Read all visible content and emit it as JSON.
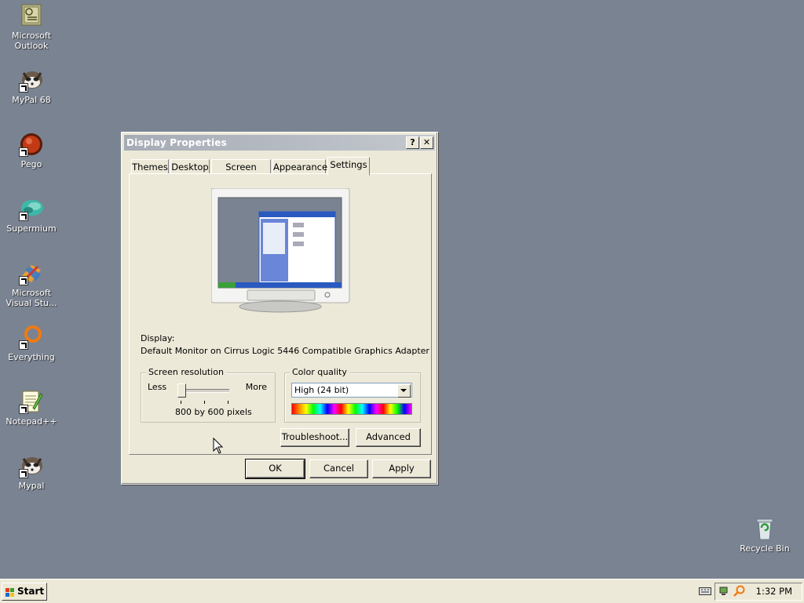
{
  "desktop": {
    "icons": [
      {
        "label": "Microsoft Outlook",
        "icon": "outlook-icon"
      },
      {
        "label": "MyPal 68",
        "icon": "raccoon-icon"
      },
      {
        "label": "Pego",
        "icon": "pego-icon"
      },
      {
        "label": "Supermium",
        "icon": "supermium-icon"
      },
      {
        "label": "Microsoft Visual Stu...",
        "icon": "visual-studio-icon"
      },
      {
        "label": "Everything",
        "icon": "everything-icon"
      },
      {
        "label": "Notepad++",
        "icon": "notepadpp-icon"
      },
      {
        "label": "Mypal",
        "icon": "raccoon-icon"
      }
    ],
    "recycle_bin": {
      "label": "Recycle Bin"
    }
  },
  "dialog": {
    "title": "Display Properties",
    "help_button": "?",
    "close_button": "✕",
    "tabs": [
      "Themes",
      "Desktop",
      "Screen Saver",
      "Appearance",
      "Settings"
    ],
    "active_tab": "Settings",
    "display_label": "Display:",
    "display_value": "Default Monitor on Cirrus Logic 5446 Compatible Graphics Adapter",
    "resolution": {
      "group_label": "Screen resolution",
      "less": "Less",
      "more": "More",
      "value_text": "800 by 600 pixels"
    },
    "color_quality": {
      "group_label": "Color quality",
      "selected": "High (24 bit)"
    },
    "troubleshoot_button": "Troubleshoot...",
    "advanced_button": "Advanced",
    "ok_button": "OK",
    "cancel_button": "Cancel",
    "apply_button": "Apply"
  },
  "taskbar": {
    "start_label": "Start",
    "clock": "1:32 PM"
  },
  "colors": {
    "desktop_bg": "#7a8391",
    "dialog_bg": "#ece9d8",
    "title_bar": "#a6acb5"
  }
}
